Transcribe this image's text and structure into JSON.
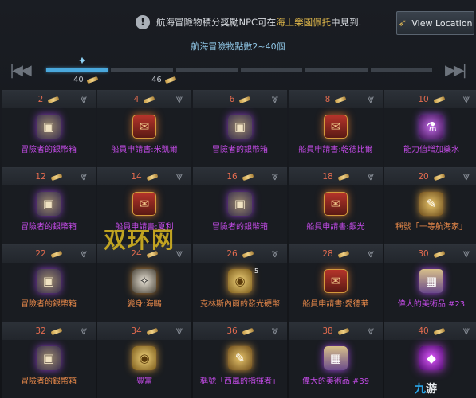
{
  "notice": {
    "prefix": "航海冒險物積分獎勵NPC可在",
    "highlight": "海上樂園佩托",
    "suffix": "中見到.",
    "icon": "warning-icon"
  },
  "view_location": {
    "label": "View Location",
    "icon": "compass-icon"
  },
  "points_range": "航海冒險物點數2~40個",
  "progress": {
    "segments": 6,
    "active_segments": 1,
    "markers": [
      {
        "value": "40"
      },
      {
        "value": "46"
      }
    ]
  },
  "rewards": [
    {
      "points": "2",
      "name": "冒險者的銀幣箱",
      "rarity": "purple",
      "icon": "chest-icon"
    },
    {
      "points": "4",
      "name": "船員申請書:米凱爾",
      "rarity": "purple",
      "icon": "crew-card-icon"
    },
    {
      "points": "6",
      "name": "冒險者的銀幣箱",
      "rarity": "purple",
      "icon": "chest-icon"
    },
    {
      "points": "8",
      "name": "船員申請書:乾德比爾",
      "rarity": "purple",
      "icon": "crew-card-icon"
    },
    {
      "points": "10",
      "name": "能力值增加藥水",
      "rarity": "purple",
      "icon": "potion-icon"
    },
    {
      "points": "12",
      "name": "冒險者的銀幣箱",
      "rarity": "purple",
      "icon": "chest-icon"
    },
    {
      "points": "14",
      "name": "船員申請書:夏利",
      "rarity": "purple",
      "icon": "crew-card-icon"
    },
    {
      "points": "16",
      "name": "冒險者的銀幣箱",
      "rarity": "purple",
      "icon": "chest-icon"
    },
    {
      "points": "18",
      "name": "船員申請書:銀光",
      "rarity": "purple",
      "icon": "crew-card-icon"
    },
    {
      "points": "20",
      "name": "稱號「一等航海家」",
      "rarity": "orange",
      "icon": "title-scroll-icon"
    },
    {
      "points": "22",
      "name": "冒險者的銀幣箱",
      "rarity": "orange",
      "icon": "chest-icon"
    },
    {
      "points": "24",
      "name": "變身:海鷗",
      "rarity": "orange",
      "icon": "seagull-icon"
    },
    {
      "points": "26",
      "name": "克林斯內爾的發光硬幣",
      "rarity": "orange",
      "icon": "coin-icon",
      "badge": "5"
    },
    {
      "points": "28",
      "name": "船員申請書:愛德華",
      "rarity": "orange",
      "icon": "crew-card-icon"
    },
    {
      "points": "30",
      "name": "偉大的美術品 #23",
      "rarity": "purple",
      "icon": "artwork-icon"
    },
    {
      "points": "32",
      "name": "冒險者的銀幣箱",
      "rarity": "orange",
      "icon": "chest-icon"
    },
    {
      "points": "34",
      "name": "豐富",
      "rarity": "purple",
      "icon": "coin-icon"
    },
    {
      "points": "36",
      "name": "稱號「西風的指揮者」",
      "rarity": "purple",
      "icon": "title-scroll-icon"
    },
    {
      "points": "38",
      "name": "偉大的美術品 #39",
      "rarity": "purple",
      "icon": "artwork-icon"
    },
    {
      "points": "40",
      "name": "",
      "rarity": "purple",
      "icon": "gem-icon"
    }
  ],
  "watermark": "双环网",
  "logo": {
    "part1": "九",
    "part2": "游"
  },
  "colors": {
    "accent": "#4aa8dc",
    "purple": "#c44be8",
    "orange": "#e8894a",
    "points": "#e26b4f",
    "highlight": "#e0b74a"
  }
}
